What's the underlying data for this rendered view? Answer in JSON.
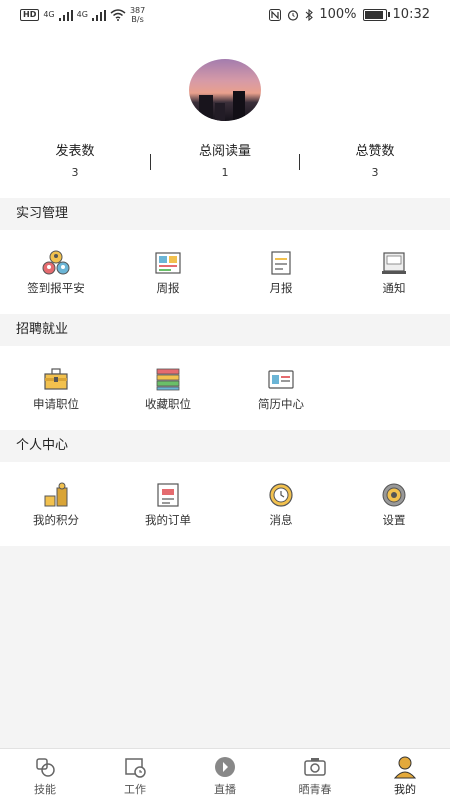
{
  "status_bar": {
    "hd": "HD",
    "net1": "4G",
    "net2": "4G",
    "speed_value": "387",
    "speed_unit": "B/s",
    "battery": "100%",
    "battery_level": 1.0,
    "time": "10:32"
  },
  "profile": {
    "stats": [
      {
        "label": "发表数",
        "value": "3"
      },
      {
        "label": "总阅读量",
        "value": "1"
      },
      {
        "label": "总赞数",
        "value": "3"
      }
    ]
  },
  "sections": [
    {
      "title": "实习管理",
      "items": [
        {
          "label": "签到报平安",
          "icon": "checkin-icon"
        },
        {
          "label": "周报",
          "icon": "weekly-report-icon"
        },
        {
          "label": "月报",
          "icon": "monthly-report-icon"
        },
        {
          "label": "通知",
          "icon": "notice-icon"
        }
      ]
    },
    {
      "title": "招聘就业",
      "items": [
        {
          "label": "申请职位",
          "icon": "briefcase-icon"
        },
        {
          "label": "收藏职位",
          "icon": "books-icon"
        },
        {
          "label": "简历中心",
          "icon": "resume-icon"
        }
      ]
    },
    {
      "title": "个人中心",
      "items": [
        {
          "label": "我的积分",
          "icon": "coins-icon"
        },
        {
          "label": "我的订单",
          "icon": "order-icon"
        },
        {
          "label": "消息",
          "icon": "message-icon"
        },
        {
          "label": "设置",
          "icon": "gear-icon"
        }
      ]
    }
  ],
  "tabbar": [
    {
      "label": "技能",
      "icon": "skill-icon"
    },
    {
      "label": "工作",
      "icon": "work-icon"
    },
    {
      "label": "直播",
      "icon": "live-icon"
    },
    {
      "label": "晒青春",
      "icon": "camera-icon"
    },
    {
      "label": "我的",
      "icon": "person-icon",
      "active": true
    }
  ],
  "colors": {
    "accent": "#e3a93b",
    "section_bg": "#f4f4f4"
  }
}
